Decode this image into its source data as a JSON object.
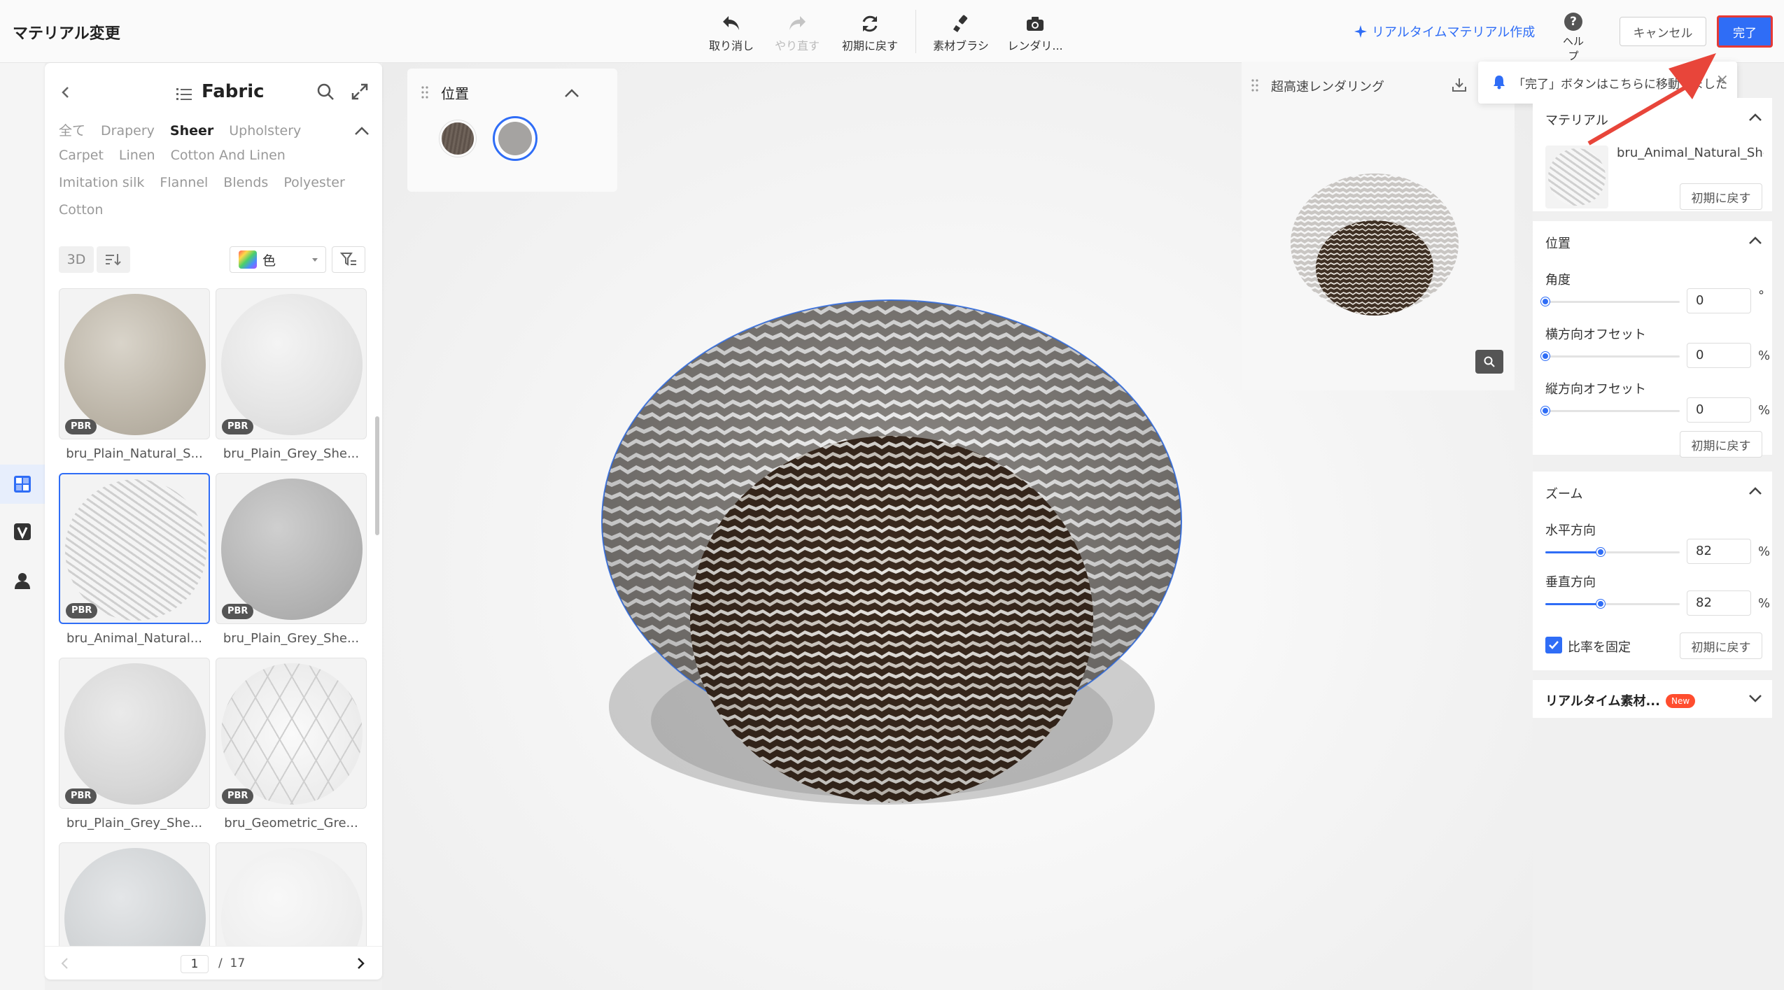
{
  "app": {
    "title": "マテリアル変更"
  },
  "toolbar": {
    "undo": "取り消し",
    "redo": "やり直す",
    "reset": "初期に戻す",
    "brush": "素材ブラシ",
    "render": "レンダリ..."
  },
  "header": {
    "realtime_link": "リアルタイムマテリアル作成",
    "help": "ヘルプ",
    "cancel": "キャンセル",
    "done": "完了"
  },
  "notice": {
    "text": "「完了」ボタンはこちらに移動しました"
  },
  "material_panel": {
    "title": "Fabric",
    "categories": [
      "全て",
      "Drapery",
      "Sheer",
      "Upholstery",
      "Carpet",
      "Linen",
      "Cotton And Linen",
      "Imitation silk",
      "Flannel",
      "Blends",
      "Polyester",
      "Cotton"
    ],
    "active_category": "Sheer",
    "chip_3d": "3D",
    "color_filter": "色",
    "badge": "PBR",
    "items": [
      {
        "name": "bru_Plain_Natural_S...",
        "selected": false
      },
      {
        "name": "bru_Plain_Grey_She...",
        "selected": false
      },
      {
        "name": "bru_Animal_Natural...",
        "selected": true
      },
      {
        "name": "bru_Plain_Grey_She...",
        "selected": false
      },
      {
        "name": "bru_Plain_Grey_She...",
        "selected": false
      },
      {
        "name": "bru_Geometric_Gre...",
        "selected": false
      },
      {
        "name": "",
        "selected": false
      },
      {
        "name": "",
        "selected": false
      }
    ],
    "pager": {
      "current": "1",
      "separator": "/",
      "total": "17"
    }
  },
  "position_panel": {
    "title": "位置"
  },
  "fast_render": {
    "title": "超高速レンダリング"
  },
  "settings": {
    "material": {
      "title": "マテリアル",
      "name": "bru_Animal_Natural_She...",
      "reset": "初期に戻す"
    },
    "position": {
      "title": "位置",
      "angle": {
        "label": "角度",
        "value": "0",
        "unit": "°",
        "level": 0
      },
      "h_offset": {
        "label": "横方向オフセット",
        "value": "0",
        "unit": "%",
        "level": 0
      },
      "v_offset": {
        "label": "縦方向オフセット",
        "value": "0",
        "unit": "%",
        "level": 0
      },
      "reset": "初期に戻す"
    },
    "zoom": {
      "title": "ズーム",
      "horizontal": {
        "label": "水平方向",
        "value": "82",
        "unit": "%",
        "level": 0.41
      },
      "vertical": {
        "label": "垂直方向",
        "value": "82",
        "unit": "%",
        "level": 0.41
      },
      "lock_ratio": "比率を固定",
      "lock_checked": true,
      "reset": "初期に戻す"
    },
    "realtime": {
      "title": "リアルタイム素材...",
      "badge": "New"
    }
  },
  "colors": {
    "accent": "#2f6df6",
    "highlight": "#e53935",
    "new_badge": "#ff4d2e"
  }
}
